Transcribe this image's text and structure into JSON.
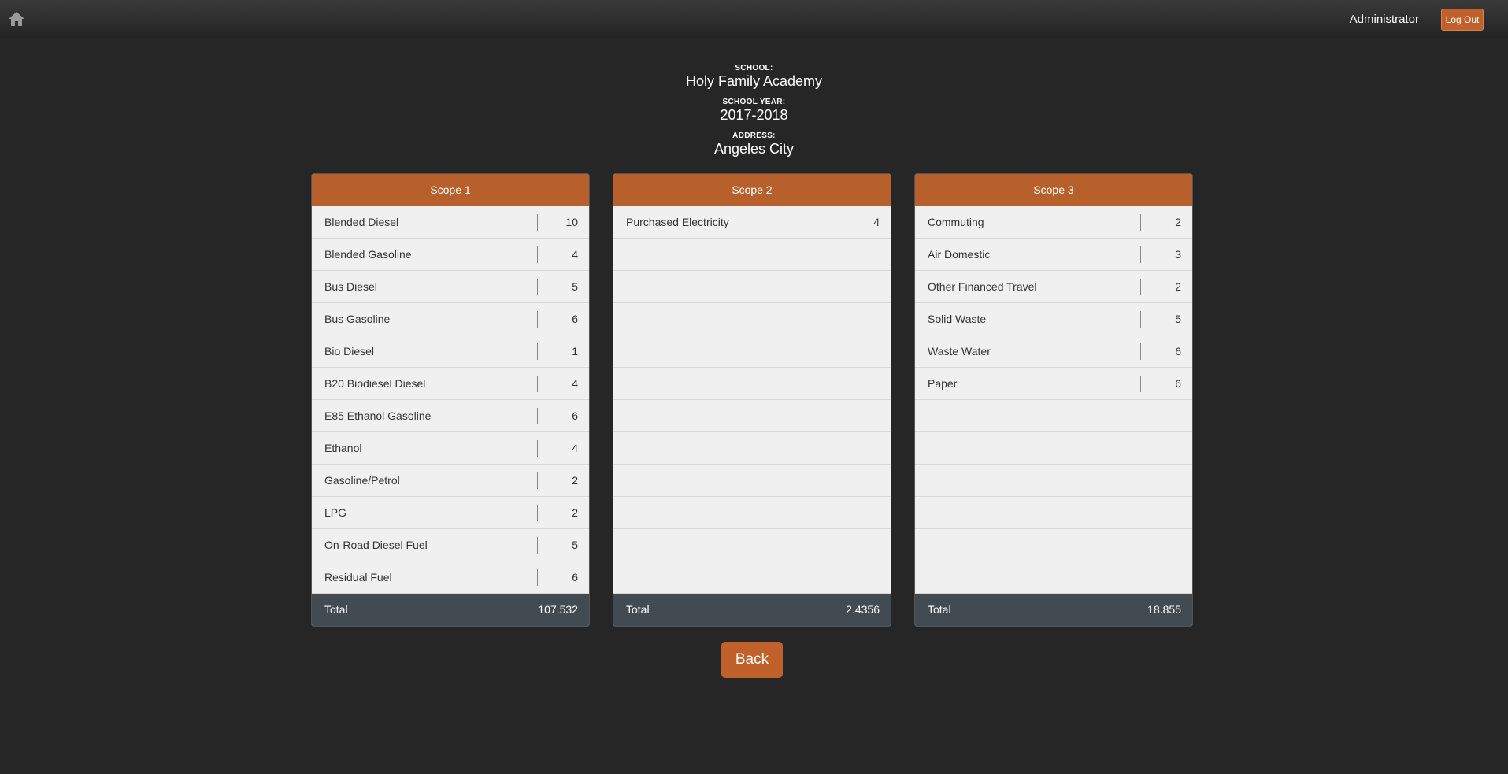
{
  "header": {
    "home_icon": "home-icon",
    "user_name": "Administrator",
    "logout_label": "Log Out",
    "accent_color": "#c0612b"
  },
  "info": {
    "school_label": "SCHOOL:",
    "school_value": "Holy Family Academy",
    "year_label": "SCHOOL YEAR:",
    "year_value": "2017-2018",
    "address_label": "ADDRESS:",
    "address_value": "Angeles City"
  },
  "scopes": [
    {
      "title": "Scope 1",
      "items": [
        {
          "name": "Blended Diesel",
          "value": "10"
        },
        {
          "name": "Blended Gasoline",
          "value": "4"
        },
        {
          "name": "Bus Diesel",
          "value": "5"
        },
        {
          "name": "Bus Gasoline",
          "value": "6"
        },
        {
          "name": "Bio Diesel",
          "value": "1"
        },
        {
          "name": "B20 Biodiesel Diesel",
          "value": "4"
        },
        {
          "name": "E85 Ethanol Gasoline",
          "value": "6"
        },
        {
          "name": "Ethanol",
          "value": "4"
        },
        {
          "name": "Gasoline/Petrol",
          "value": "2"
        },
        {
          "name": "LPG",
          "value": "2"
        },
        {
          "name": "On-Road Diesel Fuel",
          "value": "5"
        },
        {
          "name": "Residual Fuel",
          "value": "6"
        }
      ],
      "total_label": "Total",
      "total_value": "107.532"
    },
    {
      "title": "Scope 2",
      "items": [
        {
          "name": "Purchased Electricity",
          "value": "4"
        }
      ],
      "total_label": "Total",
      "total_value": "2.4356"
    },
    {
      "title": "Scope 3",
      "items": [
        {
          "name": "Commuting",
          "value": "2"
        },
        {
          "name": "Air Domestic",
          "value": "3"
        },
        {
          "name": "Other Financed Travel",
          "value": "2"
        },
        {
          "name": "Solid Waste",
          "value": "5"
        },
        {
          "name": "Waste Water",
          "value": "6"
        },
        {
          "name": "Paper",
          "value": "6"
        }
      ],
      "total_label": "Total",
      "total_value": "18.855"
    }
  ],
  "back_label": "Back"
}
